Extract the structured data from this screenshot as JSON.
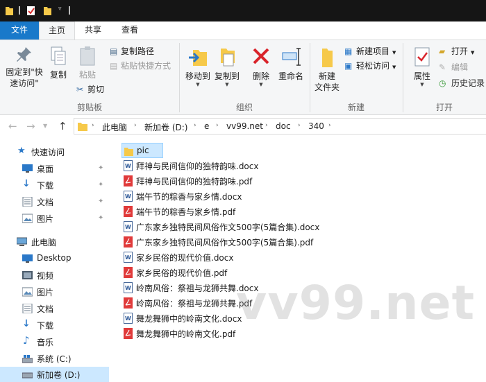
{
  "ribbon_tabs": [
    "文件",
    "主页",
    "共享",
    "查看"
  ],
  "ribbon": {
    "clipboard": {
      "pin_quick_line1": "固定到\"快",
      "pin_quick_line2": "速访问\"",
      "copy": "复制",
      "paste": "粘贴",
      "copy_path": "复制路径",
      "paste_shortcut": "粘贴快捷方式",
      "cut": "剪切",
      "group": "剪贴板"
    },
    "organize": {
      "move_to": "移动到",
      "copy_to": "复制到",
      "delete": "删除",
      "rename": "重命名",
      "group": "组织"
    },
    "new": {
      "new_folder_line1": "新建",
      "new_folder_line2": "文件夹",
      "new_item": "新建项目",
      "easy_access": "轻松访问",
      "group": "新建"
    },
    "open": {
      "properties": "属性",
      "open": "打开",
      "edit": "编辑",
      "history": "历史记录",
      "group": "打开"
    }
  },
  "breadcrumb": [
    "此电脑",
    "新加卷 (D:)",
    "e",
    "vv99.net",
    "doc",
    "340"
  ],
  "nav": {
    "quick_access": "快速访问",
    "quick_items": [
      "桌面",
      "下载",
      "文档",
      "图片"
    ],
    "this_pc": "此电脑",
    "pc_items": [
      "Desktop",
      "视频",
      "图片",
      "文档",
      "下载",
      "音乐",
      "系统 (C:)",
      "新加卷 (D:)"
    ]
  },
  "files": [
    {
      "name": "pic",
      "type": "folder"
    },
    {
      "name": "拜神与民间信仰的独特韵味.docx",
      "type": "docx"
    },
    {
      "name": "拜神与民间信仰的独特韵味.pdf",
      "type": "pdf"
    },
    {
      "name": "端午节的粽香与家乡情.docx",
      "type": "docx"
    },
    {
      "name": "端午节的粽香与家乡情.pdf",
      "type": "pdf"
    },
    {
      "name": "广东家乡独特民间风俗作文500字(5篇合集).docx",
      "type": "docx"
    },
    {
      "name": "广东家乡独特民间风俗作文500字(5篇合集).pdf",
      "type": "pdf"
    },
    {
      "name": "家乡民俗的现代价值.docx",
      "type": "docx"
    },
    {
      "name": "家乡民俗的现代价值.pdf",
      "type": "pdf"
    },
    {
      "name": "岭南风俗：祭祖与龙狮共舞.docx",
      "type": "docx"
    },
    {
      "name": "岭南风俗：祭祖与龙狮共舞.pdf",
      "type": "pdf"
    },
    {
      "name": "舞龙舞狮中的岭南文化.docx",
      "type": "docx"
    },
    {
      "name": "舞龙舞狮中的岭南文化.pdf",
      "type": "pdf"
    }
  ],
  "watermark": "vv99.net",
  "colors": {
    "accent": "#1979ca",
    "selection": "#cce8ff",
    "folder": "#f6c94a",
    "pdf": "#e03a3a",
    "docx": "#2b5797"
  }
}
